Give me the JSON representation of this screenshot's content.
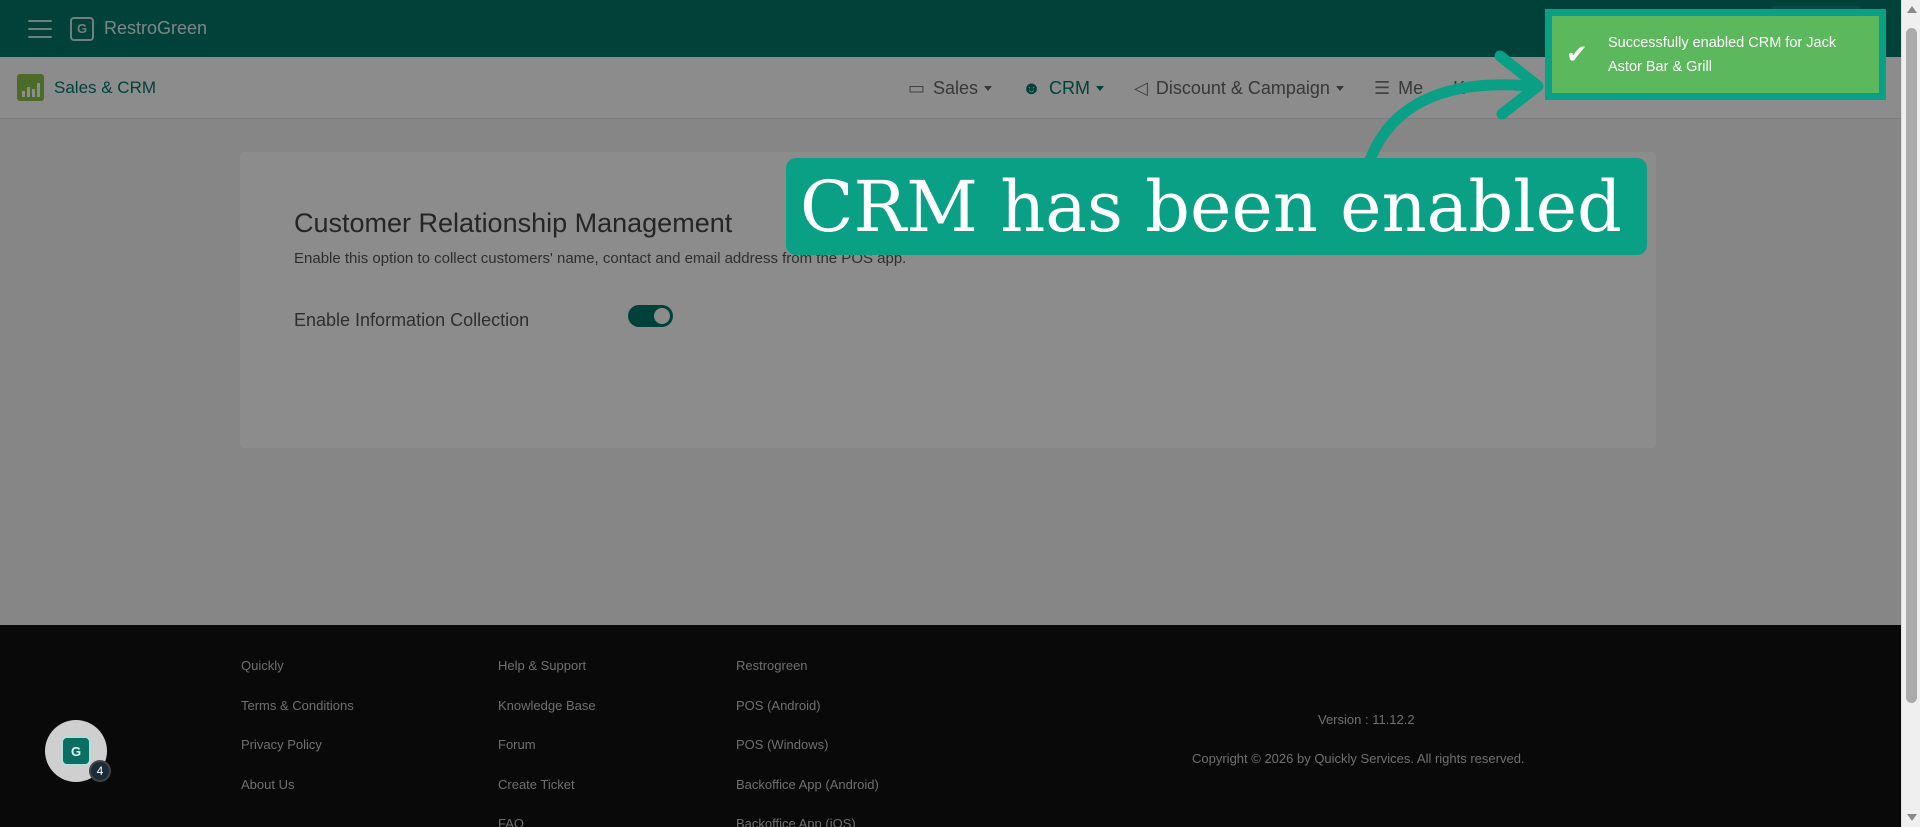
{
  "app": {
    "brand": "RestroGreen",
    "brand_logo_glyph": "G"
  },
  "subnav": {
    "module_title": "Sales & CRM",
    "items": [
      {
        "label": "Sales",
        "icon": "pos-terminal-icon"
      },
      {
        "label": "CRM",
        "icon": "users-group-icon"
      },
      {
        "label": "Discount & Campaign",
        "icon": "megaphone-icon"
      },
      {
        "label": "Me",
        "icon": "menu-list-icon"
      },
      {
        "label": "K",
        "icon": ""
      }
    ]
  },
  "card": {
    "title": "Customer Relationship Management",
    "description": "Enable this option to collect customers' name, contact and email address from the POS app.",
    "option_label": "Enable Information Collection",
    "toggle_on": true
  },
  "footer": {
    "col1": [
      "Quickly",
      "Terms & Conditions",
      "Privacy Policy",
      "About Us"
    ],
    "col2": [
      "Help & Support",
      "Knowledge Base",
      "Forum",
      "Create Ticket",
      "FAQ"
    ],
    "col3": [
      "Restrogreen",
      "POS (Android)",
      "POS (Windows)",
      "Backoffice App (Android)",
      "Backoffice App (iOS)"
    ],
    "version": "Version : 11.12.2",
    "copyright": "Copyright © 2026 by Quickly Services. All rights reserved."
  },
  "chat": {
    "badge": "4",
    "glyph": "G"
  },
  "callout": {
    "text": "CRM has been enabled"
  },
  "toast": {
    "message": "Successfully enabled CRM for Jack Astor Bar & Grill"
  },
  "colors": {
    "primary": "#00796b",
    "accent_green": "#8bc34a",
    "toast_green": "#5cb85c",
    "callout_teal": "#0aa085"
  }
}
